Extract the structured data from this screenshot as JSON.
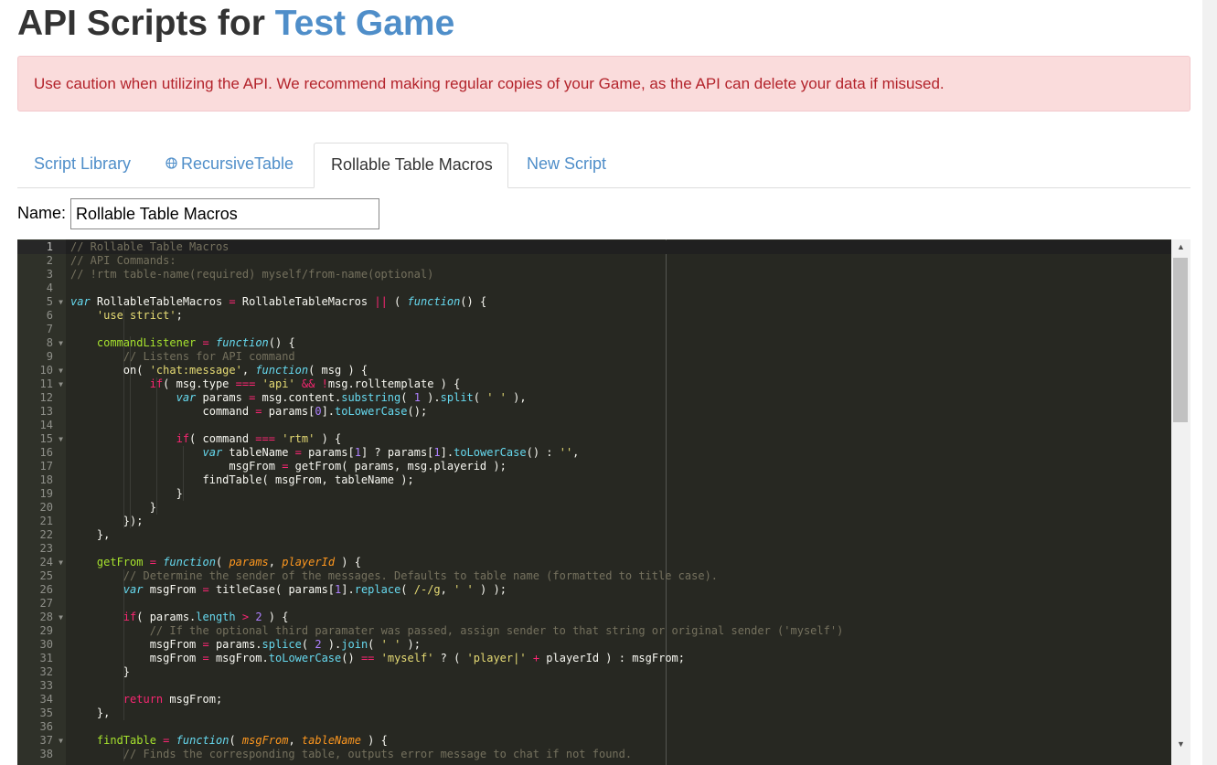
{
  "header": {
    "title_prefix": "API Scripts for ",
    "game_name": "Test Game"
  },
  "alert": {
    "text": "Use caution when utilizing the API. We recommend making regular copies of your Game, as the API can delete your data if misused."
  },
  "tabs": [
    {
      "label": "Script Library",
      "active": false,
      "icon": null
    },
    {
      "label": "RecursiveTable",
      "active": false,
      "icon": "globe-icon"
    },
    {
      "label": "Rollable Table Macros",
      "active": true,
      "icon": null
    },
    {
      "label": "New Script",
      "active": false,
      "icon": null
    }
  ],
  "form": {
    "name_label": "Name:",
    "name_value": "Rollable Table Macros"
  },
  "editor": {
    "active_line": 1,
    "line_numbers": [
      1,
      2,
      3,
      4,
      5,
      6,
      7,
      8,
      9,
      10,
      11,
      12,
      13,
      14,
      15,
      16,
      17,
      18,
      19,
      20,
      21,
      22,
      23,
      24,
      25,
      26,
      27,
      28,
      29,
      30,
      31,
      32,
      33,
      34,
      35,
      36,
      37,
      38
    ],
    "fold_lines": [
      5,
      8,
      10,
      11,
      15,
      24,
      28,
      37
    ],
    "code_lines": [
      [
        [
          "c",
          "// Rollable Table Macros"
        ]
      ],
      [
        [
          "c",
          "// API Commands:"
        ]
      ],
      [
        [
          "c",
          "// !rtm table-name(required) myself/from-name(optional)"
        ]
      ],
      [],
      [
        [
          "k",
          "var"
        ],
        [
          "t",
          " RollableTableMacros "
        ],
        [
          "o",
          "="
        ],
        [
          "t",
          " RollableTableMacros "
        ],
        [
          "o",
          "||"
        ],
        [
          "t",
          " ( "
        ],
        [
          "k",
          "function"
        ],
        [
          "t",
          "() {"
        ]
      ],
      [
        [
          "t",
          "    "
        ],
        [
          "s",
          "'use strict'"
        ],
        [
          "t",
          ";"
        ]
      ],
      [],
      [
        [
          "t",
          "    "
        ],
        [
          "fn",
          "commandListener"
        ],
        [
          "t",
          " "
        ],
        [
          "o",
          "="
        ],
        [
          "t",
          " "
        ],
        [
          "k",
          "function"
        ],
        [
          "t",
          "() {"
        ]
      ],
      [
        [
          "t",
          "        "
        ],
        [
          "c",
          "// Listens for API command"
        ]
      ],
      [
        [
          "t",
          "        on( "
        ],
        [
          "s",
          "'chat:message'"
        ],
        [
          "t",
          ", "
        ],
        [
          "k",
          "function"
        ],
        [
          "t",
          "( msg ) {"
        ]
      ],
      [
        [
          "t",
          "            "
        ],
        [
          "kw",
          "if"
        ],
        [
          "t",
          "( msg.type "
        ],
        [
          "o",
          "==="
        ],
        [
          "t",
          " "
        ],
        [
          "s",
          "'api'"
        ],
        [
          "t",
          " "
        ],
        [
          "o",
          "&&"
        ],
        [
          "t",
          " "
        ],
        [
          "o",
          "!"
        ],
        [
          "t",
          "msg.rolltemplate ) {"
        ]
      ],
      [
        [
          "t",
          "                "
        ],
        [
          "k",
          "var"
        ],
        [
          "t",
          " params "
        ],
        [
          "o",
          "="
        ],
        [
          "t",
          " msg.content."
        ],
        [
          "m",
          "substring"
        ],
        [
          "t",
          "( "
        ],
        [
          "n",
          "1"
        ],
        [
          "t",
          " )."
        ],
        [
          "m",
          "split"
        ],
        [
          "t",
          "( "
        ],
        [
          "s",
          "' '"
        ],
        [
          "t",
          " ),"
        ]
      ],
      [
        [
          "t",
          "                    command "
        ],
        [
          "o",
          "="
        ],
        [
          "t",
          " params["
        ],
        [
          "n",
          "0"
        ],
        [
          "t",
          "]."
        ],
        [
          "m",
          "toLowerCase"
        ],
        [
          "t",
          "();"
        ]
      ],
      [],
      [
        [
          "t",
          "                "
        ],
        [
          "kw",
          "if"
        ],
        [
          "t",
          "( command "
        ],
        [
          "o",
          "==="
        ],
        [
          "t",
          " "
        ],
        [
          "s",
          "'rtm'"
        ],
        [
          "t",
          " ) {"
        ]
      ],
      [
        [
          "t",
          "                    "
        ],
        [
          "k",
          "var"
        ],
        [
          "t",
          " tableName "
        ],
        [
          "o",
          "="
        ],
        [
          "t",
          " params["
        ],
        [
          "n",
          "1"
        ],
        [
          "t",
          "] ? params["
        ],
        [
          "n",
          "1"
        ],
        [
          "t",
          "]."
        ],
        [
          "m",
          "toLowerCase"
        ],
        [
          "t",
          "() : "
        ],
        [
          "s",
          "''"
        ],
        [
          "t",
          ","
        ]
      ],
      [
        [
          "t",
          "                        msgFrom "
        ],
        [
          "o",
          "="
        ],
        [
          "t",
          " getFrom( params, msg.playerid );"
        ]
      ],
      [
        [
          "t",
          "                    findTable( msgFrom, tableName );"
        ]
      ],
      [
        [
          "t",
          "                }"
        ]
      ],
      [
        [
          "t",
          "            }"
        ]
      ],
      [
        [
          "t",
          "        });"
        ]
      ],
      [
        [
          "t",
          "    },"
        ]
      ],
      [],
      [
        [
          "t",
          "    "
        ],
        [
          "fn",
          "getFrom"
        ],
        [
          "t",
          " "
        ],
        [
          "o",
          "="
        ],
        [
          "t",
          " "
        ],
        [
          "k",
          "function"
        ],
        [
          "t",
          "( "
        ],
        [
          "p",
          "params"
        ],
        [
          "t",
          ", "
        ],
        [
          "p",
          "playerId"
        ],
        [
          "t",
          " ) {"
        ]
      ],
      [
        [
          "t",
          "        "
        ],
        [
          "c",
          "// Determine the sender of the messages. Defaults to table name (formatted to title case)."
        ]
      ],
      [
        [
          "t",
          "        "
        ],
        [
          "k",
          "var"
        ],
        [
          "t",
          " msgFrom "
        ],
        [
          "o",
          "="
        ],
        [
          "t",
          " titleCase( params["
        ],
        [
          "n",
          "1"
        ],
        [
          "t",
          "]."
        ],
        [
          "m",
          "replace"
        ],
        [
          "t",
          "( "
        ],
        [
          "s",
          "/-/g"
        ],
        [
          "t",
          ", "
        ],
        [
          "s",
          "' '"
        ],
        [
          "t",
          " ) );"
        ]
      ],
      [],
      [
        [
          "t",
          "        "
        ],
        [
          "kw",
          "if"
        ],
        [
          "t",
          "( params."
        ],
        [
          "m",
          "length"
        ],
        [
          "t",
          " "
        ],
        [
          "o",
          ">"
        ],
        [
          "t",
          " "
        ],
        [
          "n",
          "2"
        ],
        [
          "t",
          " ) {"
        ]
      ],
      [
        [
          "t",
          "            "
        ],
        [
          "c",
          "// If the optional third paramater was passed, assign sender to that string or original sender ('myself')"
        ]
      ],
      [
        [
          "t",
          "            msgFrom "
        ],
        [
          "o",
          "="
        ],
        [
          "t",
          " params."
        ],
        [
          "m",
          "splice"
        ],
        [
          "t",
          "( "
        ],
        [
          "n",
          "2"
        ],
        [
          "t",
          " )."
        ],
        [
          "m",
          "join"
        ],
        [
          "t",
          "( "
        ],
        [
          "s",
          "' '"
        ],
        [
          "t",
          " );"
        ]
      ],
      [
        [
          "t",
          "            msgFrom "
        ],
        [
          "o",
          "="
        ],
        [
          "t",
          " msgFrom."
        ],
        [
          "m",
          "toLowerCase"
        ],
        [
          "t",
          "() "
        ],
        [
          "o",
          "=="
        ],
        [
          "t",
          " "
        ],
        [
          "s",
          "'myself'"
        ],
        [
          "t",
          " ? ( "
        ],
        [
          "s",
          "'player|'"
        ],
        [
          "t",
          " "
        ],
        [
          "o",
          "+"
        ],
        [
          "t",
          " playerId ) : msgFrom;"
        ]
      ],
      [
        [
          "t",
          "        }"
        ]
      ],
      [],
      [
        [
          "t",
          "        "
        ],
        [
          "kw",
          "return"
        ],
        [
          "t",
          " msgFrom;"
        ]
      ],
      [
        [
          "t",
          "    },"
        ]
      ],
      [],
      [
        [
          "t",
          "    "
        ],
        [
          "fn",
          "findTable"
        ],
        [
          "t",
          " "
        ],
        [
          "o",
          "="
        ],
        [
          "t",
          " "
        ],
        [
          "k",
          "function"
        ],
        [
          "t",
          "( "
        ],
        [
          "p",
          "msgFrom"
        ],
        [
          "t",
          ", "
        ],
        [
          "p",
          "tableName"
        ],
        [
          "t",
          " ) {"
        ]
      ],
      [
        [
          "t",
          "        "
        ],
        [
          "c",
          "// Finds the corresponding table, outputs error message to chat if not found."
        ]
      ]
    ]
  },
  "scrollbar": {
    "up_glyph": "▲",
    "down_glyph": "▼"
  }
}
